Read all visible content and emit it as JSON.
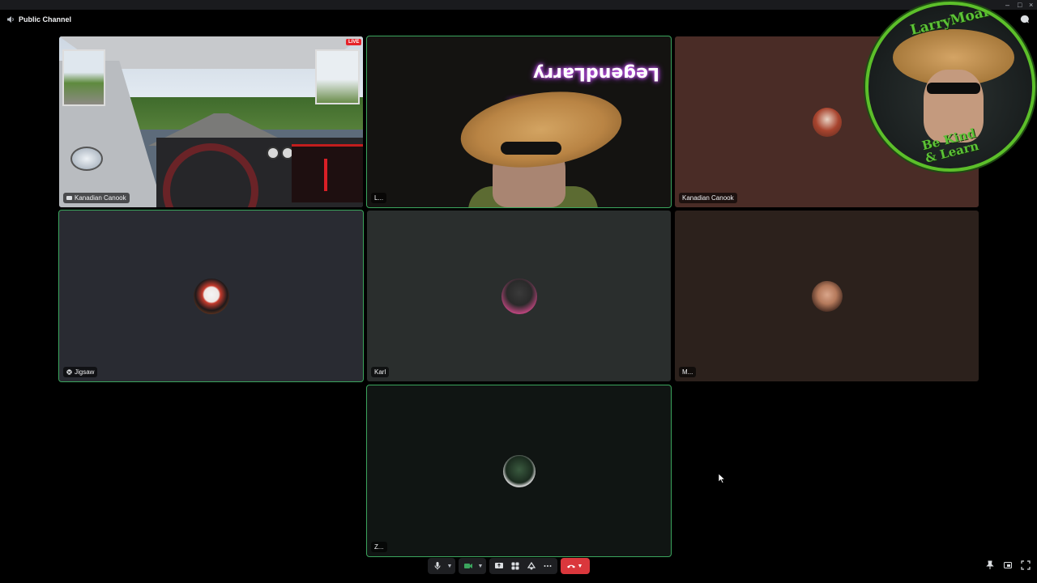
{
  "window": {
    "minimize": "–",
    "maximize": "□",
    "close": "×"
  },
  "header": {
    "channel": "Public Channel"
  },
  "tiles": {
    "stream": {
      "name": "Kanadian Canook",
      "badge": "LIVE"
    },
    "webcam": {
      "name": "L...",
      "sign": "LegendLarry"
    },
    "kanadian": {
      "name": "Kanadian Canook"
    },
    "jigsaw": {
      "name": "Jigsaw"
    },
    "karl": {
      "name": "Karl"
    },
    "m": {
      "name": "M..."
    },
    "z": {
      "name": "Z..."
    }
  },
  "overlay_logo": {
    "top_text": "LarryMoar",
    "bottom_line1": "Be Kind",
    "bottom_line2": "& Learn"
  },
  "controls": {
    "icons": [
      "microphone-icon",
      "camera-icon",
      "screen-share-icon",
      "activities-icon",
      "soundboard-icon",
      "more-icon",
      "hang-up-icon"
    ]
  },
  "colors": {
    "speaking": "#3ba55d",
    "hangup": "#da373c",
    "logo_green": "#5cc236"
  }
}
